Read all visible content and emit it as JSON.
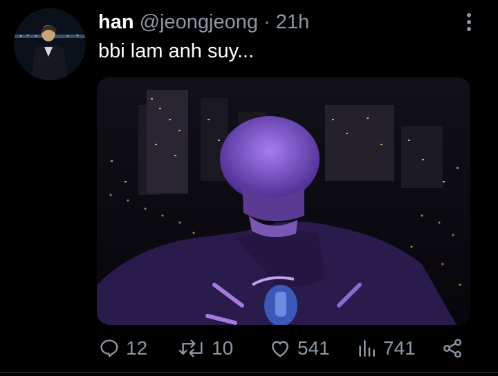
{
  "tweet": {
    "author_name": "han",
    "author_handle": "@jeongjeong",
    "separator": "·",
    "timestamp": "21h",
    "text": "bbi lam anh suy..."
  },
  "actions": {
    "reply_count": "12",
    "retweet_count": "10",
    "like_count": "541",
    "views_count": "741"
  },
  "icons": {
    "avatar": "profile-photo",
    "more": "more-vertical-icon",
    "reply": "reply-icon",
    "retweet": "retweet-icon",
    "like": "heart-icon",
    "views": "views-bar-icon",
    "share": "share-icon"
  },
  "colors": {
    "background": "#000000",
    "text_primary": "#ffffff",
    "text_secondary": "#8b98a5",
    "photo_tint": "#6a3fd0"
  }
}
